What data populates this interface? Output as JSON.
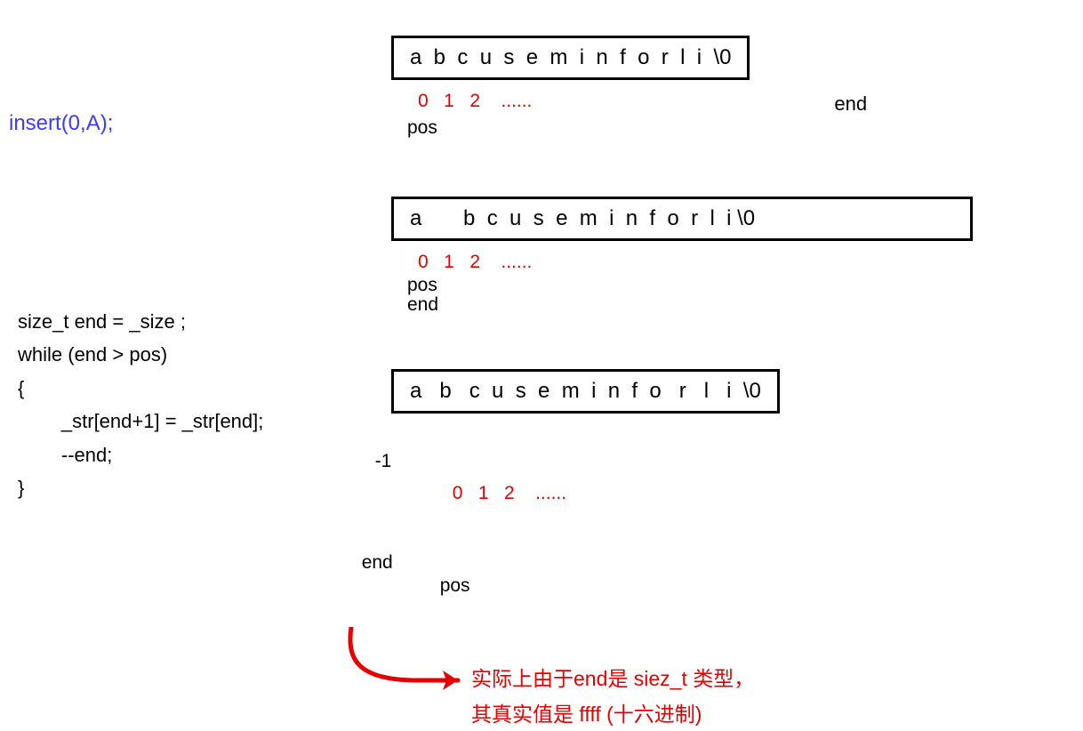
{
  "call": "insert(0,A);",
  "code": "size_t end = _size ;\nwhile (end > pos)\n{\n        _str[end+1] = _str[end];\n        --end;\n}",
  "row1": {
    "array": "a  b  c  u  s  e  m  i  n  f  o  r  l  i  \\0",
    "indices": "0   1   2    ......",
    "pos": "pos",
    "end_right": "end"
  },
  "row2": {
    "array": "a       b  c  u  s  e  m  i  n  f  o  r  l  i \\0",
    "indices": "0   1   2    ......",
    "pos": "pos",
    "end": "end"
  },
  "row3": {
    "array": "a   b   c  u  s  e  m  i  n  f  o   r   l   i  \\0",
    "neg1": "-1",
    "indices": "0   1   2    ......",
    "end": "end",
    "pos": "pos"
  },
  "annotation": {
    "line1": "实际上由于end是 siez_t 类型，",
    "line2": "其真实值是  ffff (十六进制)"
  }
}
